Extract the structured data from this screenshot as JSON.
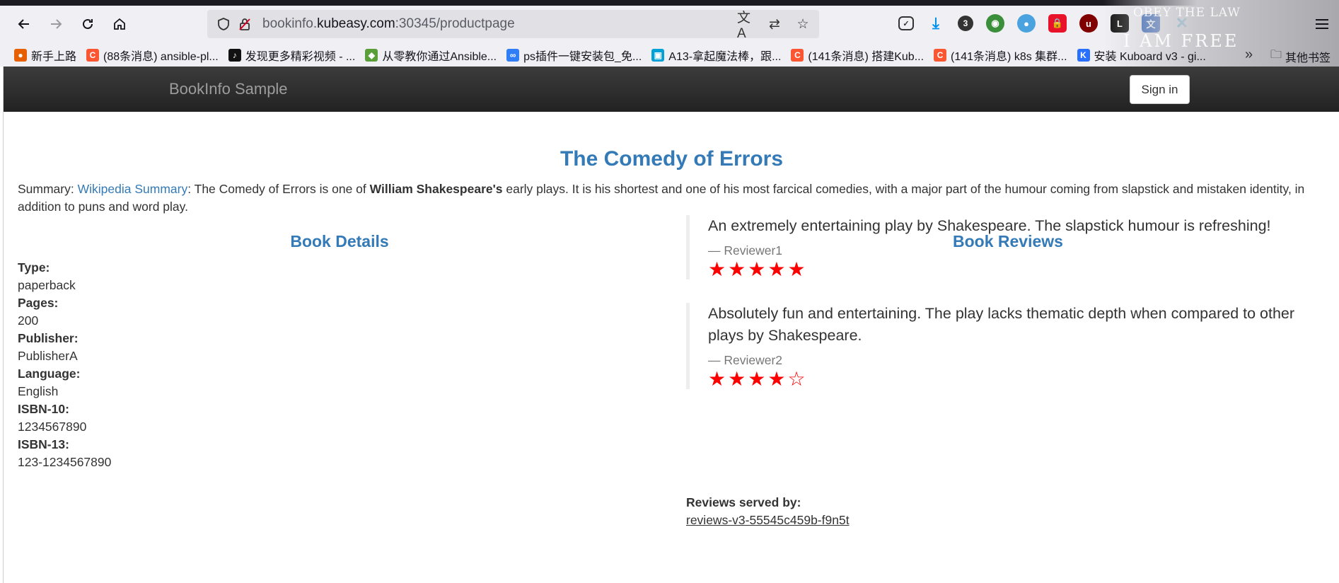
{
  "browser": {
    "url_prefix": "bookinfo.",
    "url_domain": "kubeasy.com",
    "url_suffix": ":30345/productpage",
    "badge_count": "3",
    "theme_text_top": "OBEY THE LAW",
    "theme_text_bottom": "I AM FREE",
    "bookmarks": [
      {
        "label": "新手上路",
        "color": "#e66000",
        "glyph": "●"
      },
      {
        "label": "(88条消息) ansible-pl...",
        "color": "#fc5531",
        "glyph": "C"
      },
      {
        "label": "发现更多精彩视频 - ...",
        "color": "#111111",
        "glyph": "♪"
      },
      {
        "label": "从零教你通过Ansible...",
        "color": "#5a9e3a",
        "glyph": "◆"
      },
      {
        "label": "ps插件一键安装包_免...",
        "color": "#2f7ef7",
        "glyph": "∞"
      },
      {
        "label": "A13-拿起魔法棒，跟...",
        "color": "#00a1d6",
        "glyph": "▣"
      },
      {
        "label": "(141条消息) 搭建Kub...",
        "color": "#fc5531",
        "glyph": "C"
      },
      {
        "label": "(141条消息) k8s 集群...",
        "color": "#fc5531",
        "glyph": "C"
      },
      {
        "label": "安装 Kuboard v3 - gi...",
        "color": "#2970ff",
        "glyph": "K"
      }
    ],
    "other_bookmarks": "其他书签"
  },
  "app": {
    "brand": "BookInfo Sample",
    "sign_in": "Sign in"
  },
  "book": {
    "title": "The Comedy of Errors",
    "summary_prefix": "Summary: ",
    "summary_link": "Wikipedia Summary",
    "summary_text_1": ": The Comedy of Errors is one of ",
    "summary_bold": "William Shakespeare's",
    "summary_text_2": " early plays. It is his shortest and one of his most farcical comedies, with a major part of the humour coming from slapstick and mistaken identity, in addition to puns and word play."
  },
  "details": {
    "heading": "Book Details",
    "fields": [
      {
        "key": "Type:",
        "value": "paperback"
      },
      {
        "key": "Pages:",
        "value": "200"
      },
      {
        "key": "Publisher:",
        "value": "PublisherA"
      },
      {
        "key": "Language:",
        "value": "English"
      },
      {
        "key": "ISBN-10:",
        "value": "1234567890"
      },
      {
        "key": "ISBN-13:",
        "value": "123-1234567890"
      }
    ]
  },
  "reviews": {
    "heading": "Book Reviews",
    "items": [
      {
        "text": "An extremely entertaining play by Shakespeare. The slapstick humour is refreshing!",
        "reviewer": "— Reviewer1",
        "rating": 5,
        "max": 5,
        "star_color": "#ff0000"
      },
      {
        "text": "Absolutely fun and entertaining. The play lacks thematic depth when compared to other plays by Shakespeare.",
        "reviewer": "— Reviewer2",
        "rating": 4,
        "max": 5,
        "star_color": "#ff0000"
      }
    ],
    "served_label": "Reviews served by:",
    "served_value": "reviews-v3-55545c459b-f9n5t"
  }
}
